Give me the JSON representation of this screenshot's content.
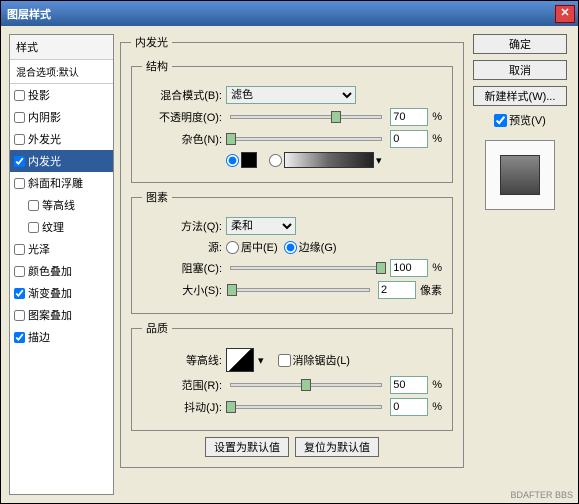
{
  "title": "图层样式",
  "sidebar": {
    "header": "样式",
    "default_item": "混合选项:默认",
    "items": [
      {
        "label": "投影",
        "checked": false,
        "active": false
      },
      {
        "label": "内阴影",
        "checked": false,
        "active": false
      },
      {
        "label": "外发光",
        "checked": false,
        "active": false
      },
      {
        "label": "内发光",
        "checked": true,
        "active": true
      },
      {
        "label": "斜面和浮雕",
        "checked": false,
        "active": false
      },
      {
        "label": "等高线",
        "checked": false,
        "active": false,
        "indent": true
      },
      {
        "label": "纹理",
        "checked": false,
        "active": false,
        "indent": true
      },
      {
        "label": "光泽",
        "checked": false,
        "active": false
      },
      {
        "label": "颜色叠加",
        "checked": false,
        "active": false
      },
      {
        "label": "渐变叠加",
        "checked": true,
        "active": false
      },
      {
        "label": "图案叠加",
        "checked": false,
        "active": false
      },
      {
        "label": "描边",
        "checked": true,
        "active": false
      }
    ]
  },
  "panel": {
    "title": "内发光",
    "structure": {
      "legend": "结构",
      "blend_label": "混合模式(B):",
      "blend_value": "滤色",
      "opacity_label": "不透明度(O):",
      "opacity_value": "70",
      "opacity_unit": "%",
      "noise_label": "杂色(N):",
      "noise_value": "0",
      "noise_unit": "%"
    },
    "elements": {
      "legend": "图素",
      "method_label": "方法(Q):",
      "method_value": "柔和",
      "source_label": "源:",
      "source_center": "居中(E)",
      "source_edge": "边缘(G)",
      "choke_label": "阻塞(C):",
      "choke_value": "100",
      "choke_unit": "%",
      "size_label": "大小(S):",
      "size_value": "2",
      "size_unit": "像素"
    },
    "quality": {
      "legend": "品质",
      "contour_label": "等高线:",
      "antialias_label": "消除锯齿(L)",
      "range_label": "范围(R):",
      "range_value": "50",
      "range_unit": "%",
      "jitter_label": "抖动(J):",
      "jitter_value": "0",
      "jitter_unit": "%"
    },
    "footer": {
      "make_default": "设置为默认值",
      "reset_default": "复位为默认值"
    }
  },
  "buttons": {
    "ok": "确定",
    "cancel": "取消",
    "new_style": "新建样式(W)...",
    "preview": "预览(V)"
  },
  "watermark": "BDAFTER BBS"
}
